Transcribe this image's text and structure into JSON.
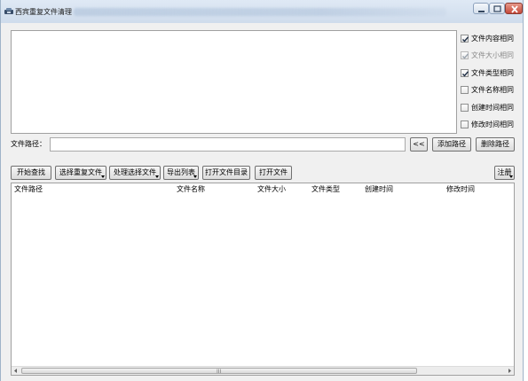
{
  "window": {
    "title": "西宾重复文件清理",
    "icon": "app-icon",
    "controls": {
      "minimize_icon": "minimize-icon",
      "maximize_icon": "maximize-icon",
      "close_icon": "close-icon"
    }
  },
  "options": [
    {
      "label": "文件内容相同",
      "checked": true,
      "enabled": true
    },
    {
      "label": "文件大小相同",
      "checked": true,
      "enabled": false
    },
    {
      "label": "文件类型相同",
      "checked": true,
      "enabled": true
    },
    {
      "label": "文件名称相同",
      "checked": false,
      "enabled": true
    },
    {
      "label": "创建时间相同",
      "checked": false,
      "enabled": true
    },
    {
      "label": "修改时间相同",
      "checked": false,
      "enabled": true
    }
  ],
  "path_row": {
    "label": "文件路径：",
    "value": "",
    "browse_label": "<<",
    "add_label": "添加路径",
    "delete_label": "删除路径"
  },
  "toolbar": {
    "start_label": "开始查找",
    "select_dup_label": "选择重复文件",
    "process_label": "处理选择文件",
    "export_label": "导出列表",
    "open_dir_label": "打开文件目录",
    "open_file_label": "打开文件",
    "register_label": "注册"
  },
  "table": {
    "columns": [
      "文件路径",
      "文件名称",
      "文件大小",
      "文件类型",
      "创建时间",
      "修改时间"
    ],
    "rows": []
  },
  "scrollbar": {
    "grip": "III"
  }
}
